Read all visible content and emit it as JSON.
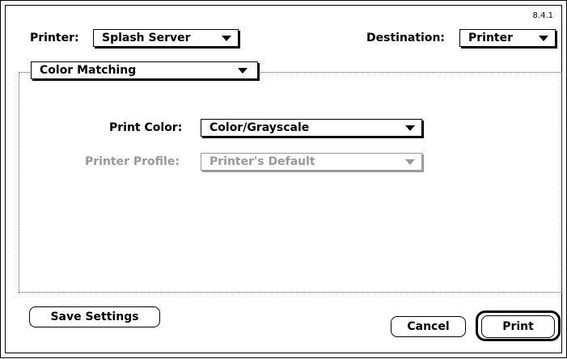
{
  "version": "8.4.1",
  "printer": {
    "label": "Printer:",
    "value": "Splash Server"
  },
  "destination": {
    "label": "Destination:",
    "value": "Printer"
  },
  "section": {
    "value": "Color Matching"
  },
  "print_color": {
    "label": "Print Color:",
    "value": "Color/Grayscale"
  },
  "printer_profile": {
    "label": "Printer Profile:",
    "value": "Printer's Default"
  },
  "buttons": {
    "save_settings": "Save Settings",
    "cancel": "Cancel",
    "print": "Print"
  }
}
